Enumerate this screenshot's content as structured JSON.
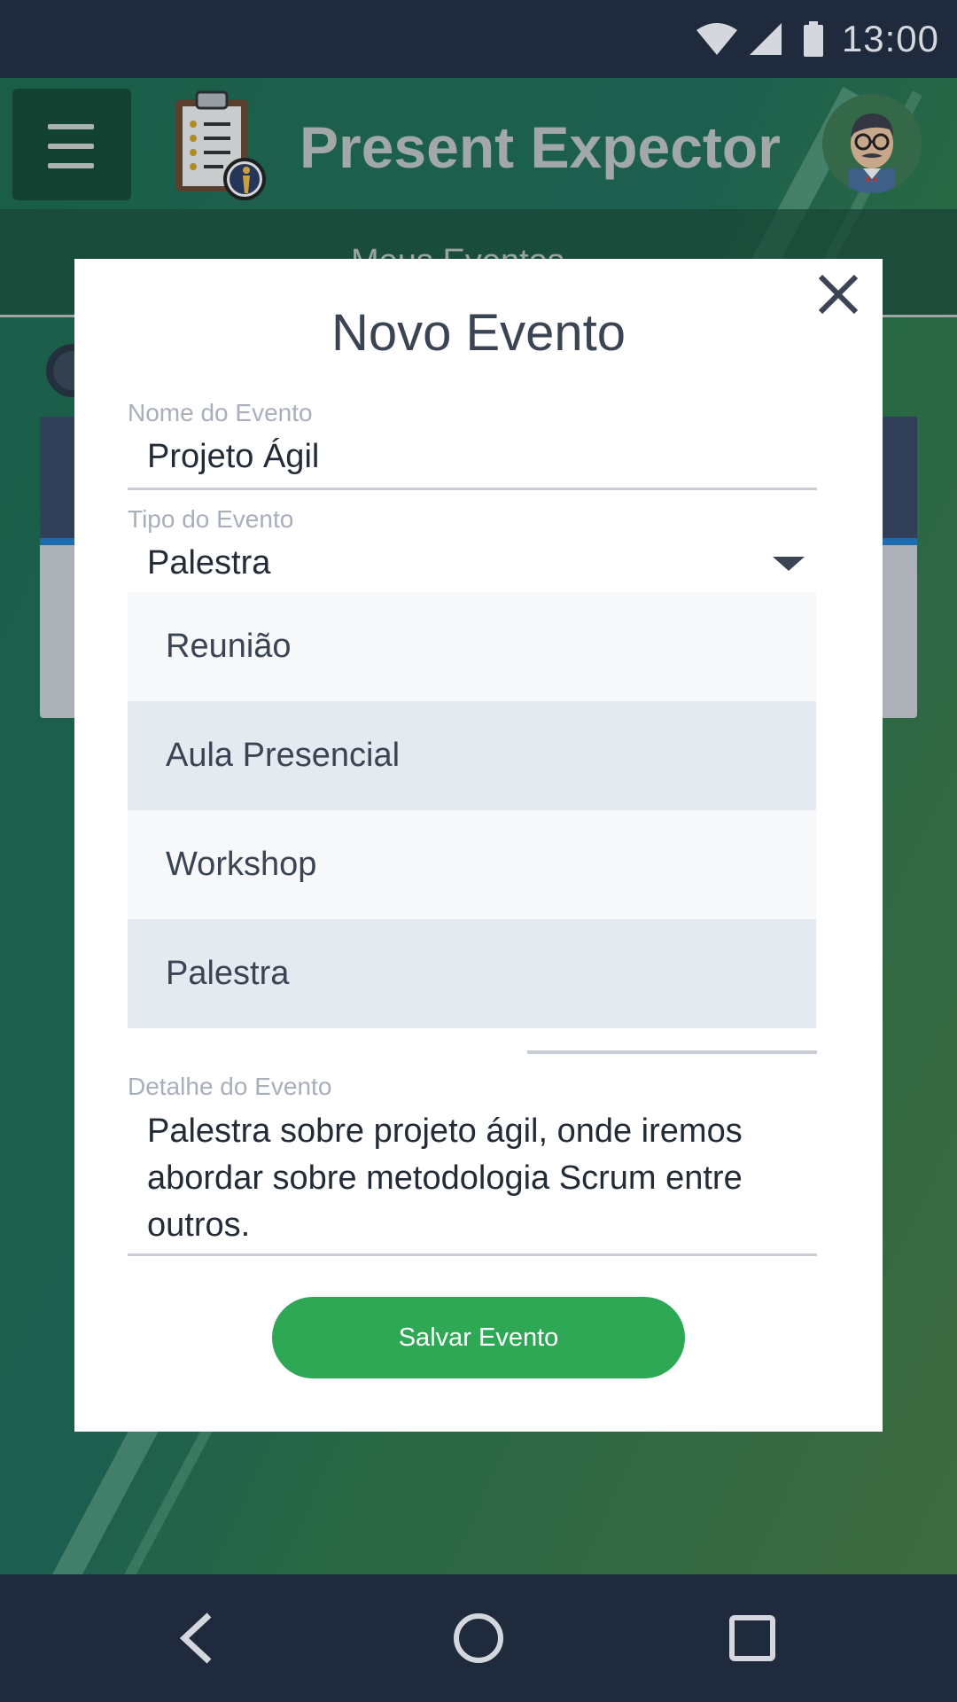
{
  "status_bar": {
    "time": "13:00"
  },
  "app_bar": {
    "title": "Present Expector"
  },
  "tabs": {
    "active_label": "Meus Eventos"
  },
  "modal": {
    "title": "Novo Evento",
    "fields": {
      "name": {
        "label": "Nome do Evento",
        "value": "Projeto Ágil"
      },
      "type": {
        "label": "Tipo do Evento",
        "value": "Palestra"
      },
      "detail": {
        "label": "Detalhe do Evento",
        "value": "Palestra sobre projeto ágil, onde iremos abordar sobre metodologia Scrum entre outros."
      }
    },
    "type_options": [
      "Reunião",
      "Aula Presencial",
      "Workshop",
      "Palestra"
    ],
    "save_label": "Salvar Evento"
  },
  "colors": {
    "accent": "#2ea854",
    "app_green": "#22705a",
    "status_bar": "#1f2a3d"
  },
  "icons": [
    "wifi-icon",
    "signal-icon",
    "battery-icon",
    "menu-icon",
    "clipboard-logo-icon",
    "avatar-icon",
    "close-icon",
    "chevron-down-icon",
    "back-icon",
    "home-icon",
    "recents-icon"
  ]
}
